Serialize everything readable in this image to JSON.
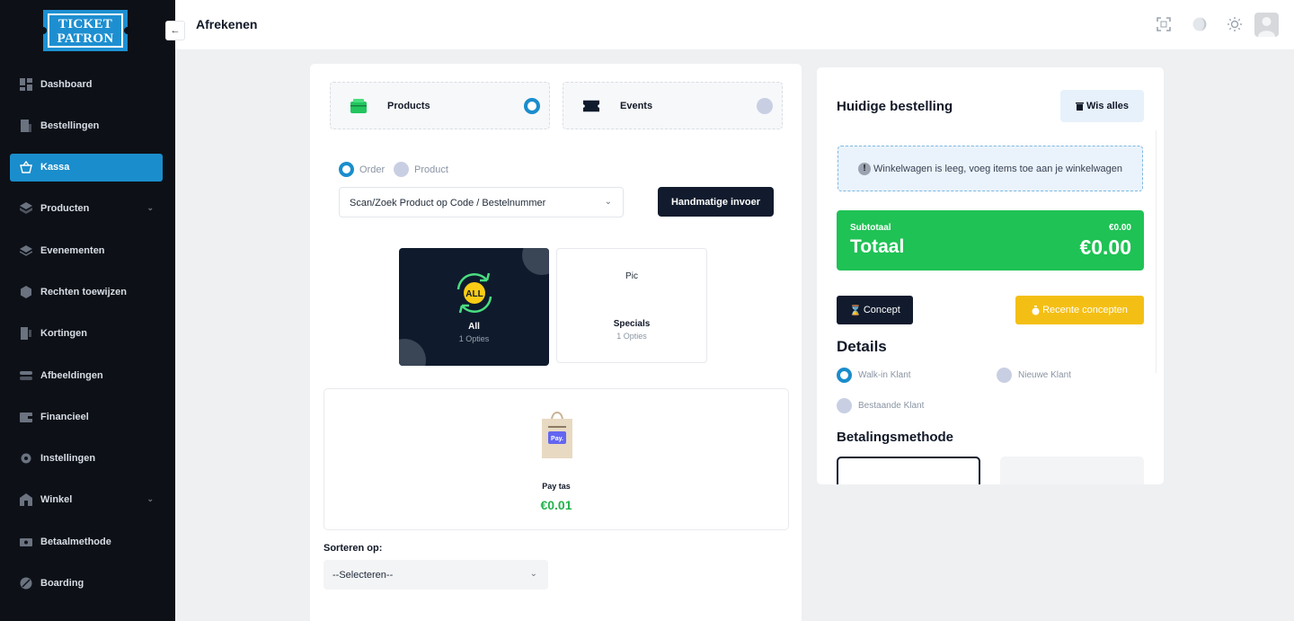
{
  "app": {
    "logo_text_line1": "TICKET",
    "logo_text_line2": "PATRON",
    "page_title": "Afrekenen"
  },
  "sidebar": {
    "items": [
      {
        "label": "Dashboard",
        "icon": "dashboard-icon",
        "active": false
      },
      {
        "label": "Bestellingen",
        "icon": "orders-icon",
        "active": false
      },
      {
        "label": "Kassa",
        "icon": "basket-icon",
        "active": true
      },
      {
        "label": "Producten",
        "icon": "box-icon",
        "active": false,
        "has_submenu": true
      },
      {
        "label": "Evenementen",
        "icon": "layers-icon",
        "active": false
      },
      {
        "label": "Rechten toewijzen",
        "icon": "cube-icon",
        "active": false
      },
      {
        "label": "Kortingen",
        "icon": "discount-icon",
        "active": false
      },
      {
        "label": "Afbeeldingen",
        "icon": "image-icon",
        "active": false
      },
      {
        "label": "Financieel",
        "icon": "wallet-icon",
        "active": false
      },
      {
        "label": "Instellingen",
        "icon": "gear-icon",
        "active": false
      },
      {
        "label": "Winkel",
        "icon": "shop-icon",
        "active": false,
        "has_submenu": true
      },
      {
        "label": "Betaalmethode",
        "icon": "payment-icon",
        "active": false
      },
      {
        "label": "Boarding",
        "icon": "rocket-icon",
        "active": false
      }
    ]
  },
  "checkout": {
    "types": [
      {
        "label": "Products",
        "selected": true,
        "icon": "box-icon"
      },
      {
        "label": "Events",
        "selected": false,
        "icon": "ticket-icon"
      }
    ],
    "modes": [
      {
        "label": "Order",
        "selected": true
      },
      {
        "label": "Product",
        "selected": false
      }
    ],
    "search_placeholder": "Scan/Zoek Product op Code / Bestelnummer",
    "manual_button": "Handmatige invoer",
    "categories": [
      {
        "name": "All",
        "options": "1 Opties",
        "badge": "ALL",
        "active": true
      },
      {
        "name": "Specials",
        "options": "1 Opties",
        "image_alt": "Pic",
        "active": false
      }
    ],
    "products": [
      {
        "name": "Pay tas",
        "price": "€0.01",
        "bag_text": "Pay."
      }
    ],
    "sort_label": "Sorteren op:",
    "sort_value": "--Selecteren--"
  },
  "order": {
    "title": "Huidige bestelling",
    "clear_button": "Wis alles",
    "empty_message": "Winkelwagen is leeg, voeg items toe aan je winkelwagen",
    "subtotal_label": "Subtotaal",
    "subtotal_value": "€0.00",
    "total_label": "Totaal",
    "total_value": "€0.00",
    "concept_button": "Concept",
    "recent_button": "Recente concepten",
    "details_title": "Details",
    "customer_options": [
      {
        "label": "Walk-in Klant",
        "selected": true
      },
      {
        "label": "Nieuwe Klant",
        "selected": false
      },
      {
        "label": "Bestaande Klant",
        "selected": false
      }
    ],
    "payment_title": "Betalingsmethode"
  },
  "colors": {
    "accent": "#1a8dcc",
    "dark": "#111b2d",
    "success": "#1fc255",
    "warning": "#f4bf15"
  }
}
